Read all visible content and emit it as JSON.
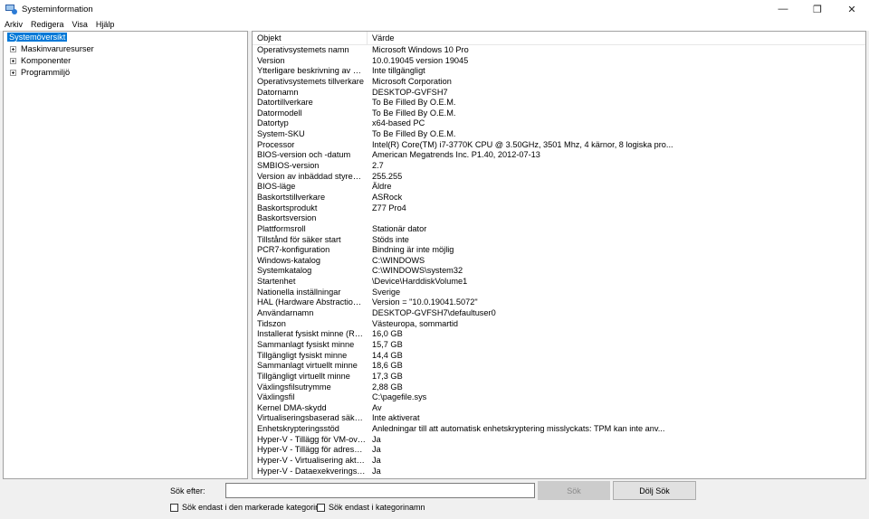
{
  "window": {
    "title": "Systeminformation",
    "controls": {
      "minimize": "—",
      "maximize": "❐",
      "close": "✕"
    }
  },
  "menu": [
    "Arkiv",
    "Redigera",
    "Visa",
    "Hjälp"
  ],
  "tree": {
    "root": "Systemöversikt",
    "children": [
      "Maskinvaruresurser",
      "Komponenter",
      "Programmiljö"
    ]
  },
  "list": {
    "columns": [
      "Objekt",
      "Värde"
    ],
    "rows": [
      [
        "Operativsystemets namn",
        "Microsoft Windows 10 Pro"
      ],
      [
        "Version",
        "10.0.19045 version 19045"
      ],
      [
        "Ytterligare beskrivning av oper...",
        "Inte tillgängligt"
      ],
      [
        "Operativsystemets tillverkare",
        "Microsoft Corporation"
      ],
      [
        "Datornamn",
        "DESKTOP-GVFSH7"
      ],
      [
        "Datortillverkare",
        "To Be Filled By O.E.M."
      ],
      [
        "Datormodell",
        "To Be Filled By O.E.M."
      ],
      [
        "Datortyp",
        "x64-based PC"
      ],
      [
        "System-SKU",
        "To Be Filled By O.E.M."
      ],
      [
        "Processor",
        "Intel(R) Core(TM) i7-3770K CPU @ 3.50GHz, 3501 Mhz, 4 kärnor, 8 logiska pro..."
      ],
      [
        "BIOS-version och -datum",
        "American Megatrends Inc. P1.40, 2012-07-13"
      ],
      [
        "SMBIOS-version",
        "2.7"
      ],
      [
        "Version av inbäddad styrenhet",
        "255.255"
      ],
      [
        "BIOS-läge",
        "Äldre"
      ],
      [
        "Baskortstillverkare",
        "ASRock"
      ],
      [
        "Baskortsprodukt",
        "Z77 Pro4"
      ],
      [
        "Baskortsversion",
        ""
      ],
      [
        "Plattformsroll",
        "Stationär dator"
      ],
      [
        "Tillstånd för säker start",
        "Stöds inte"
      ],
      [
        "PCR7-konfiguration",
        "Bindning är inte möjlig"
      ],
      [
        "Windows-katalog",
        "C:\\WINDOWS"
      ],
      [
        "Systemkatalog",
        "C:\\WINDOWS\\system32"
      ],
      [
        "Startenhet",
        "\\Device\\HarddiskVolume1"
      ],
      [
        "Nationella inställningar",
        "Sverige"
      ],
      [
        "HAL (Hardware Abstraction Lay...",
        "Version = \"10.0.19041.5072\""
      ],
      [
        "Användarnamn",
        "DESKTOP-GVFSH7\\defaultuser0"
      ],
      [
        "Tidszon",
        "Västeuropa, sommartid"
      ],
      [
        "Installerat fysiskt minne (RAM)",
        "16,0 GB"
      ],
      [
        "Sammanlagt fysiskt minne",
        "15,7 GB"
      ],
      [
        "Tillgängligt fysiskt minne",
        "14,4 GB"
      ],
      [
        "Sammanlagt virtuellt minne",
        "18,6 GB"
      ],
      [
        "Tillgängligt virtuellt minne",
        "17,3 GB"
      ],
      [
        "Växlingsfilsutrymme",
        "2,88 GB"
      ],
      [
        "Växlingsfil",
        "C:\\pagefile.sys"
      ],
      [
        "Kernel DMA-skydd",
        "Av"
      ],
      [
        "Virtualiseringsbaserad säkerhet",
        "Inte aktiverat"
      ],
      [
        "Enhetskrypteringsstöd",
        "Anledningar till att automatisk enhetskryptering misslyckats: TPM kan inte anv..."
      ],
      [
        "Hyper-V - Tillägg för VM-overv...",
        "Ja"
      ],
      [
        "Hyper-V - Tillägg för adressön...",
        "Ja"
      ],
      [
        "Hyper-V - Virtualisering aktiver...",
        "Ja"
      ],
      [
        "Hyper-V - Dataexekveringsskydd",
        "Ja"
      ]
    ]
  },
  "search": {
    "label": "Sök efter:",
    "value": "",
    "search_button": "Sök",
    "hide_button": "Dölj Sök",
    "check_selected": "Sök endast i den markerade kategorin",
    "check_names": "Sök endast i kategorinamn"
  },
  "colors": {
    "selection": "#0078d7",
    "border": "#a0a0a0",
    "disabled_button": "#cccccc"
  }
}
